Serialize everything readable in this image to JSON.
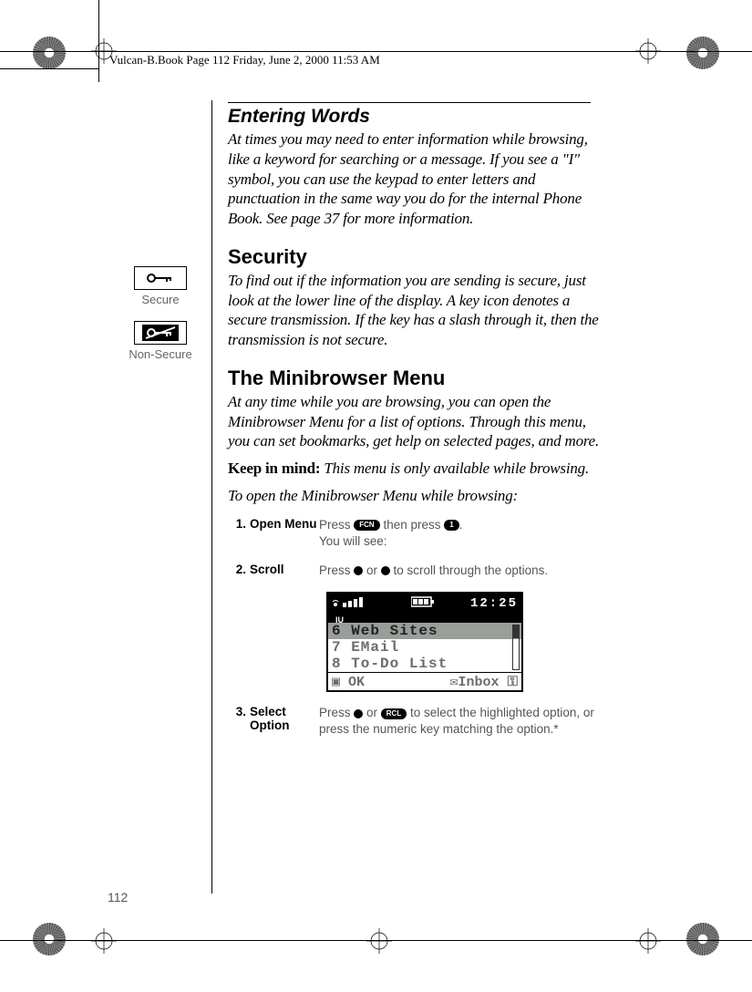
{
  "header": "Vulcan-B.Book  Page 112  Friday, June 2, 2000  11:53 AM",
  "page_number": "112",
  "sidebar": {
    "secure_label": "Secure",
    "nonsecure_label": "Non-Secure"
  },
  "sections": {
    "s1": {
      "title": "Entering Words",
      "body": "At times you may need to enter information while browsing, like a keyword for searching or a message. If you see a \"I\" symbol, you can use the keypad to enter letters and punctuation in the same way you do for the internal Phone Book. See page 37 for more information."
    },
    "s2": {
      "title": "Security",
      "body": "To find out if the information you are sending is secure, just look at the lower line of the display. A key icon denotes a secure transmission. If the key has a slash through it, then the transmission is not secure."
    },
    "s3": {
      "title": "The Minibrowser Menu",
      "body1": "At any time while you are browsing, you can open the Minibrowser Menu for a list of options. Through this menu, you can set bookmarks, get help on selected pages, and more.",
      "body2_prefix": "Keep in mind:",
      "body2_rest": " This menu is only available while browsing.",
      "body3": "To open the Minibrowser Menu while browsing:"
    }
  },
  "steps": [
    {
      "num": "1.",
      "label": "Open Menu",
      "desc_pre": "Press ",
      "key1": "FCN",
      "desc_mid": " then press ",
      "key2": "1",
      "desc_post": ".",
      "line2": "You will see:"
    },
    {
      "num": "2.",
      "label": "Scroll",
      "desc_pre": "Press ",
      "desc_mid": " or ",
      "desc_post": " to scroll through the options."
    },
    {
      "num": "3.",
      "label": "Select Option",
      "desc_pre": "Press ",
      "desc_mid": " or ",
      "key2": "RCL",
      "desc_post": " to select the highlighted option, or press the numeric key matching the option.*"
    }
  ],
  "lcd": {
    "time": "12:25",
    "rows": [
      "6 Web Sites",
      "7 EMail",
      "8 To-Do List"
    ],
    "footer_left": "OK",
    "footer_right": "Inbox"
  }
}
